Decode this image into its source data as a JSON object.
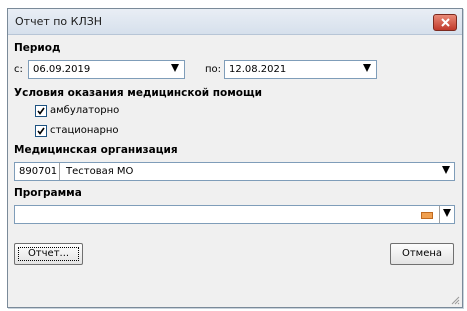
{
  "window": {
    "title": "Отчет по КЛЗН",
    "close_icon": "close-icon"
  },
  "period": {
    "section_title": "Период",
    "from_label": "с:",
    "from_value": "06.09.2019",
    "to_label": "по:",
    "to_value": "12.08.2021"
  },
  "conditions": {
    "section_title": "Условия оказания медицинской помощи",
    "options": [
      {
        "label": "амбулаторно",
        "checked": true
      },
      {
        "label": "стационарно",
        "checked": true
      }
    ]
  },
  "organization": {
    "section_title": "Медицинская организация",
    "code": "890701",
    "name": "Тестовая МО"
  },
  "program": {
    "section_title": "Программа",
    "value": "",
    "clear_icon": "clear-icon"
  },
  "buttons": {
    "report": "Отчет...",
    "cancel": "Отмена"
  },
  "colors": {
    "close_button": "#c0392b",
    "clear_icon": "#f0a050",
    "field_border": "#7f9db9"
  }
}
